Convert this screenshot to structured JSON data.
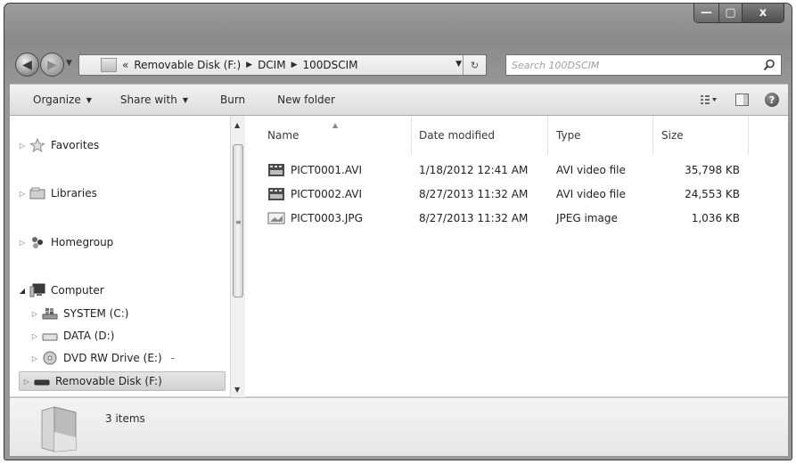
{
  "window": {
    "minimize_label": "—",
    "maximize_label": "▢",
    "close_label": "x"
  },
  "nav": {
    "back_icon": "back-arrow-icon",
    "forward_icon": "forward-arrow-icon",
    "address_separator": "«",
    "address_path": [
      "Removable Disk (F:)",
      "DCIM",
      "100DSCIM"
    ],
    "search_placeholder": "Search 100DSCIM"
  },
  "toolbar": {
    "organize": "Organize",
    "share_with": "Share with",
    "burn": "Burn",
    "new_folder": "New folder"
  },
  "sidebar": {
    "items": [
      {
        "label": "Favorites",
        "icon": "star-icon"
      },
      {
        "label": "Libraries",
        "icon": "library-icon"
      },
      {
        "label": "Homegroup",
        "icon": "homegroup-icon"
      },
      {
        "label": "Computer",
        "icon": "computer-icon"
      },
      {
        "label": "SYSTEM (C:)",
        "icon": "system-drive-icon"
      },
      {
        "label": "DATA (D:)",
        "icon": "drive-icon"
      },
      {
        "label": "DVD RW Drive (E:)",
        "icon": "dvd-icon",
        "suffix": "-"
      },
      {
        "label": "Removable Disk (F:)",
        "icon": "removable-disk-icon"
      }
    ]
  },
  "columns": {
    "name": "Name",
    "date_modified": "Date modified",
    "type": "Type",
    "size": "Size"
  },
  "files": [
    {
      "name": "PICT0001.AVI",
      "date": "1/18/2012 12:41 AM",
      "type": "AVI video file",
      "size": "35,798 KB",
      "icon": "video-file-icon"
    },
    {
      "name": "PICT0002.AVI",
      "date": "8/27/2013 11:32 AM",
      "type": "AVI video file",
      "size": "24,553 KB",
      "icon": "video-file-icon"
    },
    {
      "name": "PICT0003.JPG",
      "date": "8/27/2013 11:32 AM",
      "type": "JPEG image",
      "size": "1,036 KB",
      "icon": "image-file-icon"
    }
  ],
  "details": {
    "item_count": "3 items"
  }
}
